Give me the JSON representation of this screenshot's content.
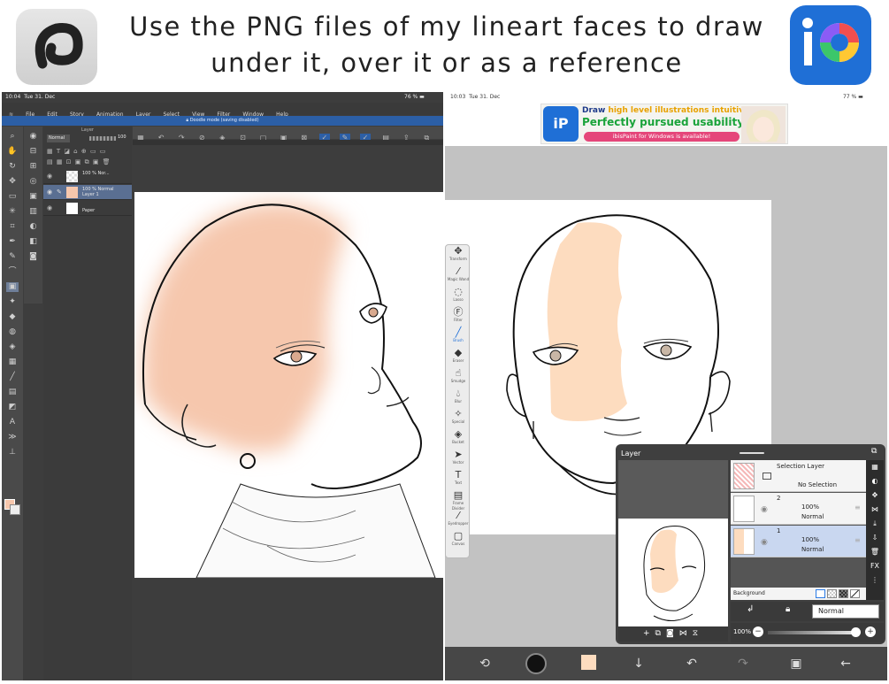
{
  "header": {
    "caption_line1": "Use the PNG files of my lineart faces to draw",
    "caption_line2": "under it, over it or as a reference"
  },
  "clip_studio": {
    "status": {
      "time": "10:04",
      "date": "Tue 31. Dec",
      "battery": "76 %"
    },
    "menu": [
      "File",
      "Edit",
      "Story",
      "Animation",
      "Layer",
      "Select",
      "View",
      "Filter",
      "Window",
      "Help"
    ],
    "banner": "Doodle mode (saving disabled)",
    "layer_panel": {
      "title": "Layer",
      "blend_mode": "Normal",
      "opacity": "100",
      "layers": [
        {
          "label_line1": "100 % Nor...",
          "label_line2": ""
        },
        {
          "label_line1": "100 % Normal",
          "label_line2": "Layer 1"
        },
        {
          "label_line1": "",
          "label_line2": "Paper"
        }
      ]
    },
    "colors": {
      "skin": "#f6c7ad",
      "ui_dark": "#3d3d3d",
      "banner": "#2c5fa6"
    }
  },
  "ibis_paint": {
    "status": {
      "time": "10:03",
      "date": "Tue 31. Dec",
      "battery": "77 %"
    },
    "ad": {
      "line1_prefix": "Draw ",
      "line1_highlight": "high level illustrations intuitively!",
      "line2": "Perfectly pursued usability!",
      "line3": "ibisPaint for Windows is available!"
    },
    "tools": [
      "Transform",
      "Magic Wand",
      "Lasso",
      "Filter",
      "Brush",
      "Eraser",
      "Smudge",
      "Blur",
      "Special",
      "Bucket",
      "Vector",
      "Text",
      "Frame Divider",
      "Eyedropper",
      "Canvas"
    ],
    "layer_window": {
      "title": "Layer",
      "selection_layer": {
        "title": "Selection Layer",
        "status": "No Selection"
      },
      "layers": [
        {
          "number": "2",
          "opacity": "100%",
          "blend": "Normal"
        },
        {
          "number": "1",
          "opacity": "100%",
          "blend": "Normal"
        }
      ],
      "background_label": "Background",
      "blend_mode": "Normal",
      "opacity": "100%"
    },
    "colors": {
      "skin": "#fddcbf",
      "accent_blue": "#1f6fd6"
    }
  }
}
